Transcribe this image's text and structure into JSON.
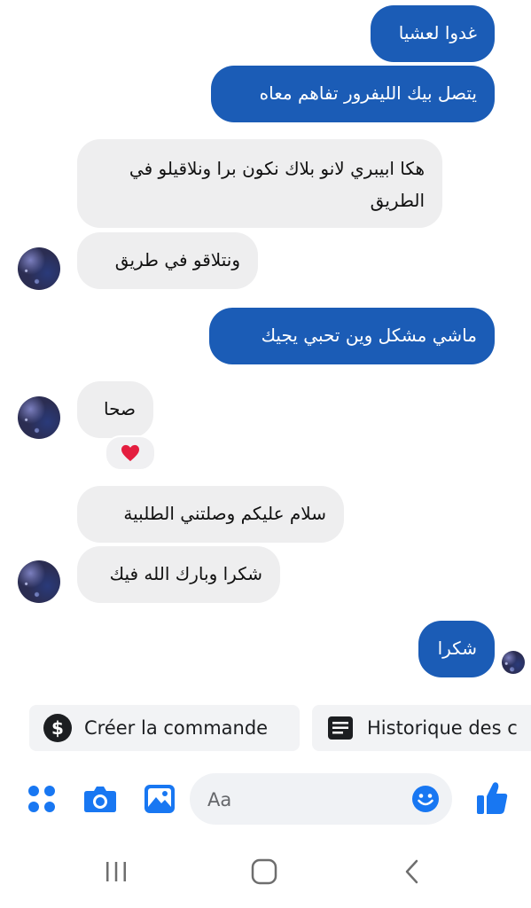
{
  "messages": [
    {
      "text": "غدوا لعشيا"
    },
    {
      "text": "يتصل بيك الليفرور تفاهم معاه"
    },
    {
      "text": "هكا ابيبري لانو بلاك نكون برا ونلاقيلو في الطريق"
    },
    {
      "text": "ونتلاقو في طريق"
    },
    {
      "text": "ماشي مشكل وين تحبي يجيك"
    },
    {
      "text": "صحا"
    },
    {
      "text": "سلام عليكم وصلتني الطلبية"
    },
    {
      "text": "شكرا وبارك الله فيك"
    },
    {
      "text": "شكرا"
    }
  ],
  "reaction": {
    "icon": "heart-icon",
    "color": "#e41e3f"
  },
  "quick_actions": {
    "create_order": {
      "label": "Créer la commande",
      "icon": "dollar-icon"
    },
    "history": {
      "label": "Historique des c",
      "icon": "list-icon"
    }
  },
  "composer": {
    "placeholder": "Aa",
    "icons": [
      "menu-dots-icon",
      "camera-icon",
      "gallery-icon",
      "emoji-icon",
      "thumbs-up-icon"
    ],
    "accent": "#1877f2"
  },
  "colors": {
    "outgoing_bubble": "#1b5cb6",
    "incoming_bubble": "#eeeeef"
  }
}
